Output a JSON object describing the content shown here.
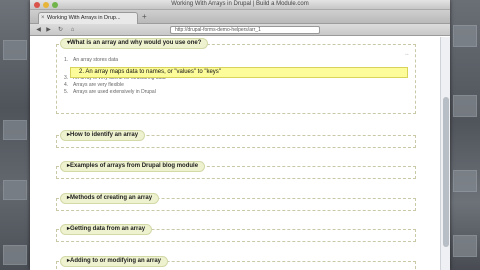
{
  "window": {
    "title": "Working With Arrays in Drupal | Build a Module.com",
    "tab_label": "Working With Arrays in Drup...",
    "url": "http://drupal-forms-demo-helpers/arr_1"
  },
  "sections": [
    {
      "label": "What is an array and why would you use one?",
      "expanded": true
    },
    {
      "label": "How to identify an array",
      "expanded": false
    },
    {
      "label": "Examples of arrays from Drupal blog module",
      "expanded": false
    },
    {
      "label": "Methods of creating an array",
      "expanded": false
    },
    {
      "label": "Getting data from an array",
      "expanded": false
    },
    {
      "label": "Adding to or modifying an array",
      "expanded": false
    }
  ],
  "points": [
    {
      "num": "1.",
      "text": "An array stores data"
    },
    {
      "num": "2.",
      "text": "An array maps data to names, or \"values\" to \"keys\""
    },
    {
      "num": "3.",
      "text": "An array is very useful for structuring data"
    },
    {
      "num": "4.",
      "text": "Arrays are very flexible"
    },
    {
      "num": "5.",
      "text": "Arrays are used extensively in Drupal"
    }
  ],
  "highlight_index": 1,
  "corner_mark": "◦◦",
  "new_tab_symbol": "+",
  "tab_close_symbol": "×",
  "nav": {
    "back": "◀",
    "forward": "▶",
    "reload": "↻",
    "home": "⌂"
  },
  "colors": {
    "highlight": "#fdfc9a",
    "section_header": "#eef2cf"
  }
}
